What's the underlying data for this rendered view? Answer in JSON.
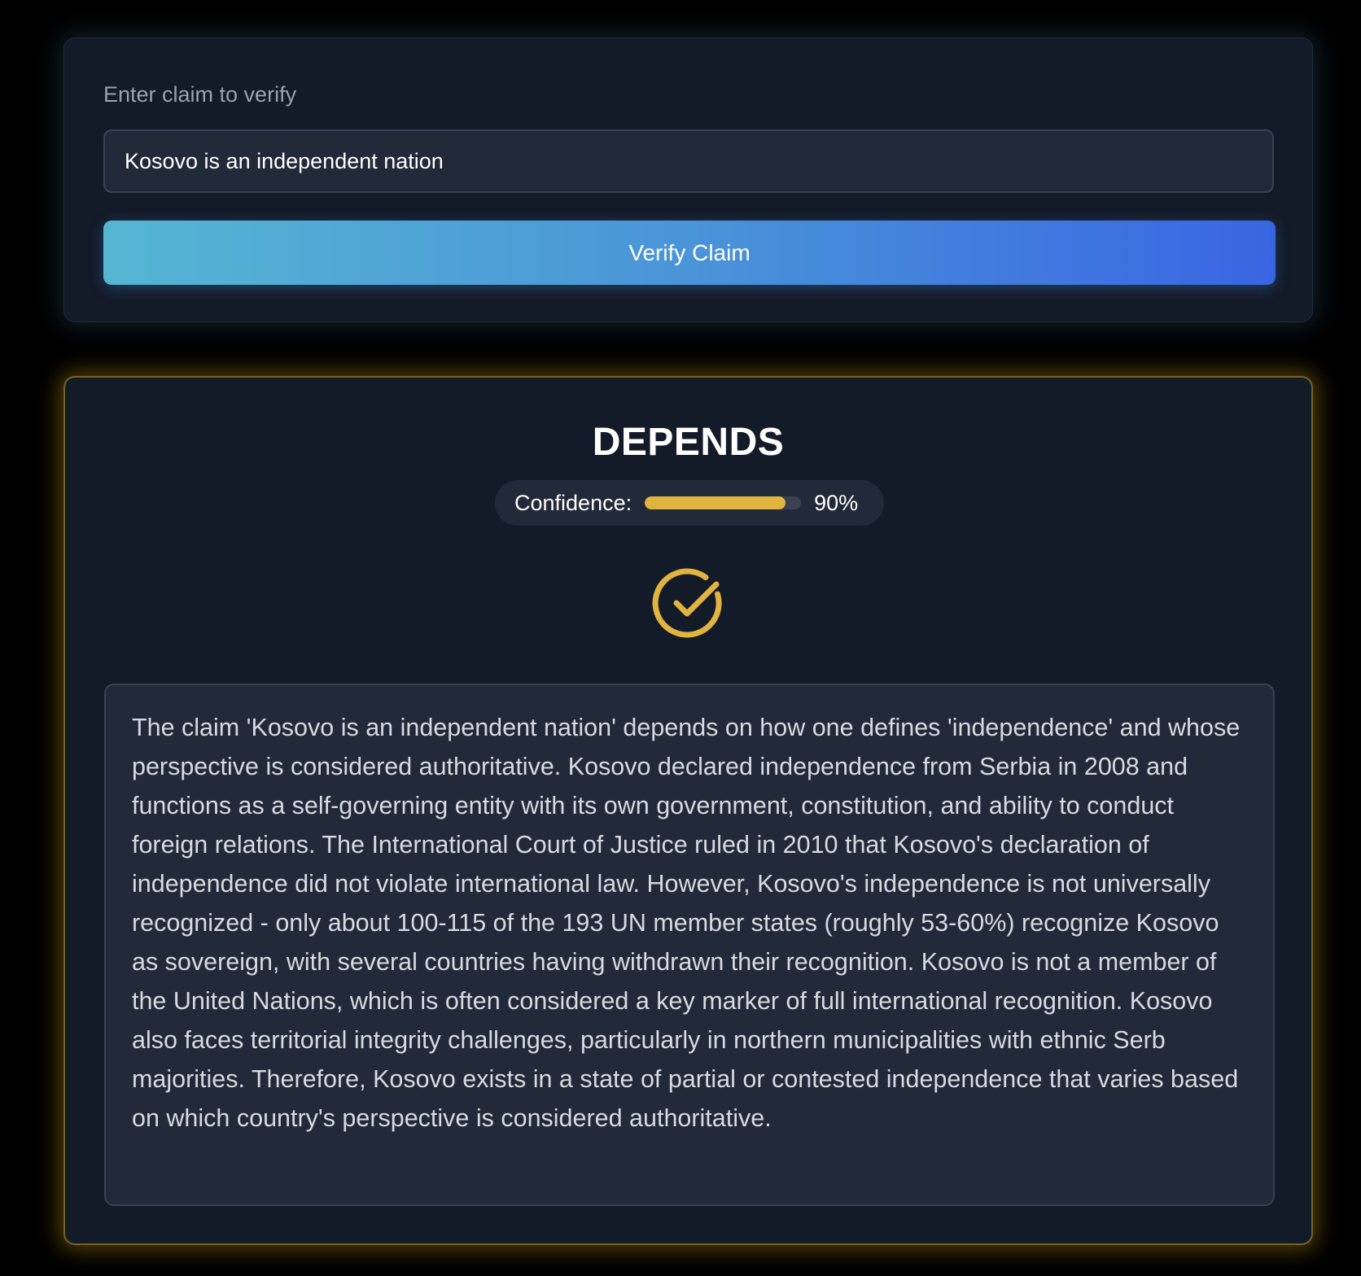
{
  "claim_form": {
    "label": "Enter claim to verify",
    "claim_value": "Kosovo is an independent nation",
    "verify_button_label": "Verify Claim"
  },
  "result": {
    "verdict": "DEPENDS",
    "confidence_label": "Confidence:",
    "confidence_value": "90%",
    "confidence_fraction": 0.9,
    "verdict_icon": "check-circle-icon",
    "accent_color": "#e0b43f",
    "explanation": "The claim 'Kosovo is an independent nation' depends on how one defines 'independence' and whose perspective is considered authoritative. Kosovo declared independence from Serbia in 2008 and functions as a self-governing entity with its own government, constitution, and ability to conduct foreign relations. The International Court of Justice ruled in 2010 that Kosovo's declaration of independence did not violate international law. However, Kosovo's independence is not universally recognized - only about 100-115 of the 193 UN member states (roughly 53-60%) recognize Kosovo as sovereign, with several countries having withdrawn their recognition. Kosovo is not a member of the United Nations, which is often considered a key marker of full international recognition. Kosovo also faces territorial integrity challenges, particularly in northern municipalities with ethnic Serb majorities. Therefore, Kosovo exists in a state of partial or contested independence that varies based on which country's perspective is considered authoritative."
  }
}
